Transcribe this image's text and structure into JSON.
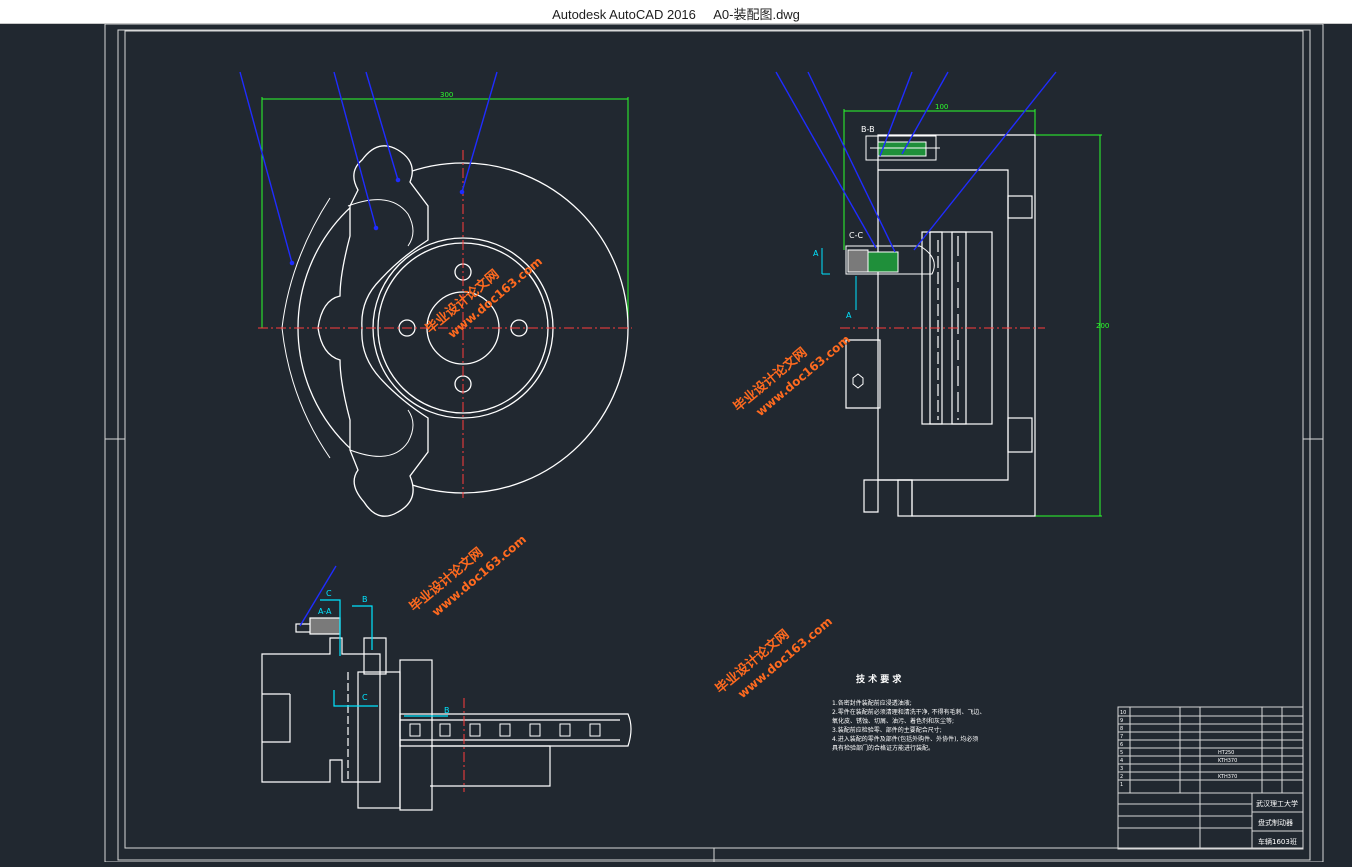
{
  "window": {
    "title": "Autodesk AutoCAD 2016     A0-装配图.dwg"
  },
  "colors": {
    "background": "#212830",
    "lines": "#ffffff",
    "centerlines": "#ff3b3b",
    "dimensions": "#2cff2c",
    "leaders": "#1f2cff",
    "sections": "#00e5ff",
    "watermark": "#ff6a1f"
  },
  "drawing": {
    "section_labels": {
      "bb": "B-B",
      "cc": "C-C",
      "a": "A",
      "aa": "A-A",
      "c": "C",
      "b": "B"
    },
    "tech_requirements": {
      "title": "技 术 要 求",
      "lines": [
        "1.各密封件装配前应浸透油液;",
        "2.零件在装配前必须清理和清洗干净, 不得有毛刺、飞边、",
        "  氧化皮、锈蚀、切屑、油污、着色剂和灰尘等;",
        "3.装配前应检验零、部件的主要配合尺寸;",
        "4.进入装配的零件及部件(包括外购件、外协件), 均必须",
        "  具有检验部门的合格证方能进行装配。"
      ]
    },
    "title_block": {
      "school": "武汉理工大学",
      "drawing_name": "盘式制动器",
      "class": "车辆1603班",
      "materials": [
        "HT250",
        "KTH370",
        "KTH370"
      ],
      "row_numbers": [
        "10",
        "9",
        "8",
        "7",
        "6",
        "5",
        "4",
        "3",
        "2",
        "1"
      ]
    },
    "watermark": {
      "brand": "毕业设计论文网",
      "url": "www.doc163.com"
    },
    "icons": [
      "hex-nut-icon"
    ]
  }
}
